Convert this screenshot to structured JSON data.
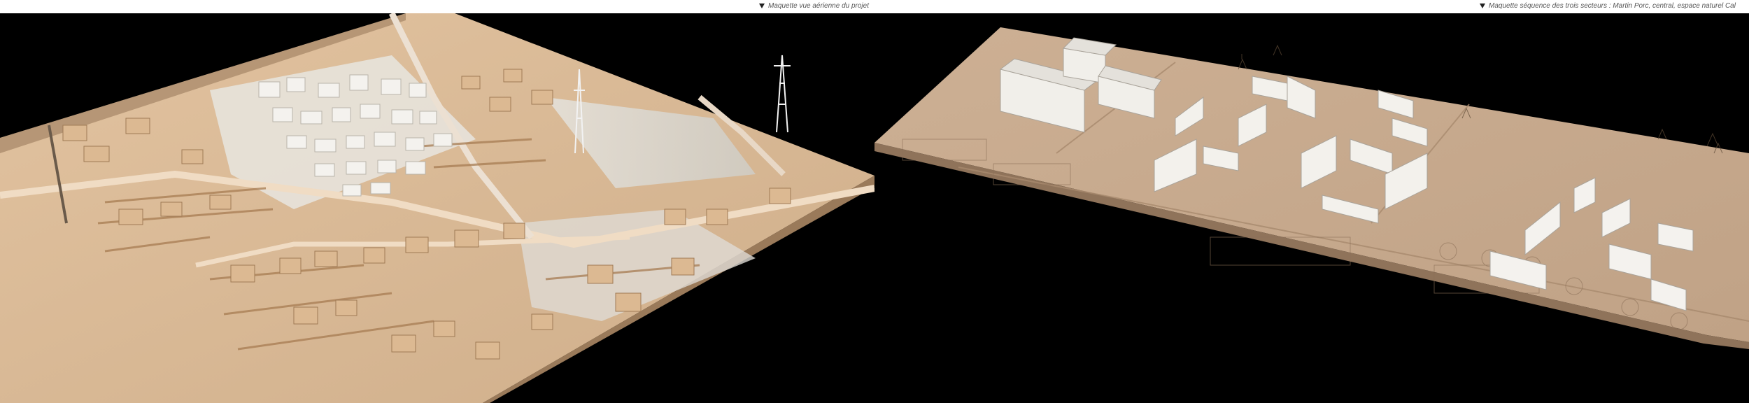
{
  "captions": {
    "left": "Maquette vue aérienne du projet",
    "right": "Maquette séquence des trois secteurs : Martin Porc, central, espace naturel Cal"
  },
  "icons": {
    "caption_marker": "triangle-down-icon"
  },
  "colors": {
    "background": "#000000",
    "caption_bar": "#ffffff",
    "wood": "#d9b994",
    "wood_dark": "#b08c66",
    "white_block": "#f1efea",
    "base_right": "#c8aa8c"
  }
}
